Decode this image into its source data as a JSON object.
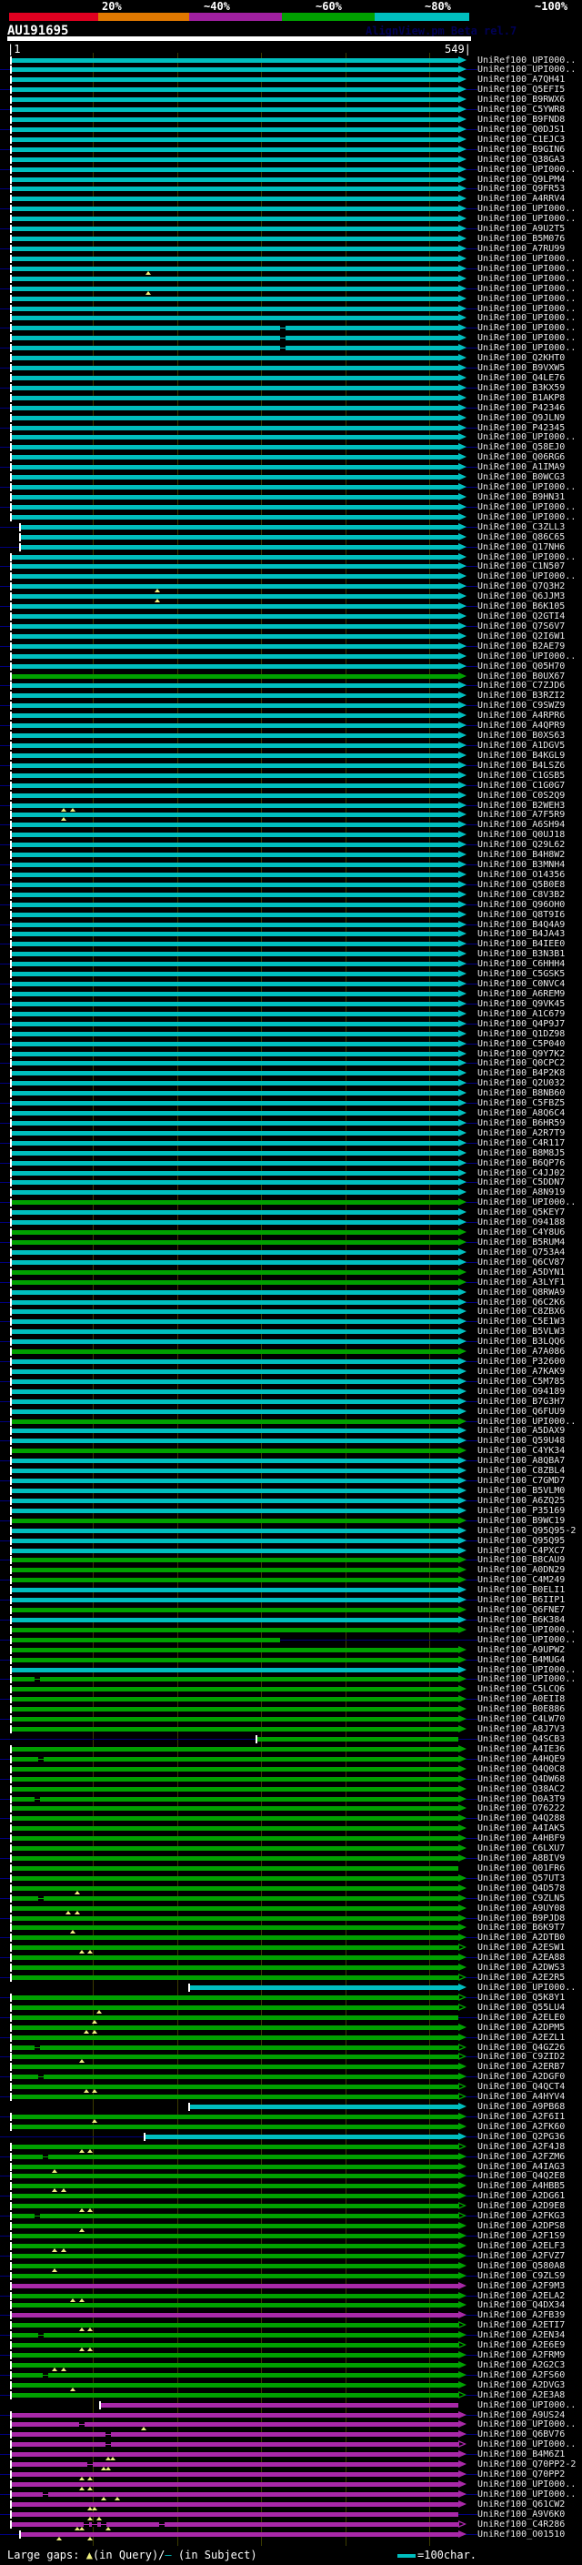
{
  "header": {
    "title": "AU191695",
    "watermark": "AlignView.pm Beta rel.7",
    "percent_labels": [
      "20%",
      "~40%",
      "~60%",
      "~80%",
      "~100%"
    ],
    "percent_label_x": [
      112,
      224,
      347,
      467,
      588
    ],
    "key_colors": [
      "#e00020",
      "#e07800",
      "#a020a0",
      "#00a000",
      "#00bebe"
    ],
    "key_widths": [
      98,
      100,
      102,
      102,
      104
    ],
    "scale_start": "|1",
    "scale_end": "549|"
  },
  "legend": {
    "prefix": "Large gaps: ",
    "triangle": "▲",
    "mid": "(in Query)/",
    "dash": "—",
    "suffix": " (in Subject)",
    "scale_label": "=100char."
  },
  "colors": {
    "cyan": "#00bebe",
    "green": "#00a000",
    "purple": "#a828a8",
    "navy": "#000080",
    "grid": "#3c3c00",
    "yellow": "#f0f080"
  },
  "grid_x": [
    102,
    195,
    287,
    380,
    472
  ],
  "rows": [
    [
      "UniRef100_UPI000..",
      "c",
      {}
    ],
    [
      "UniRef100_UPI000..",
      "c",
      {}
    ],
    [
      "UniRef100_A7QH41",
      "c",
      {}
    ],
    [
      "UniRef100_Q5EFI5",
      "c",
      {}
    ],
    [
      "UniRef100_B9RWX6",
      "c",
      {}
    ],
    [
      "UniRef100_C5YWR8",
      "c",
      {}
    ],
    [
      "UniRef100_B9FND8",
      "c",
      {}
    ],
    [
      "UniRef100_Q0DJS1",
      "c",
      {}
    ],
    [
      "UniRef100_C1EJC3",
      "c",
      {}
    ],
    [
      "UniRef100_B9GIN6",
      "c",
      {}
    ],
    [
      "UniRef100_Q38GA3",
      "c",
      {}
    ],
    [
      "UniRef100_UPI000..",
      "c",
      {}
    ],
    [
      "UniRef100_Q9LPM4",
      "c",
      {}
    ],
    [
      "UniRef100_Q9FR53",
      "c",
      {}
    ],
    [
      "UniRef100_A4RRV4",
      "c",
      {}
    ],
    [
      "UniRef100_UPI000..",
      "c",
      {}
    ],
    [
      "UniRef100_UPI000..",
      "c",
      {}
    ],
    [
      "UniRef100_A9U2T5",
      "c",
      {}
    ],
    [
      "UniRef100_B5M076",
      "c",
      {}
    ],
    [
      "UniRef100_A7RU99",
      "c",
      {}
    ],
    [
      "UniRef100_UPI000..",
      "c",
      {}
    ],
    [
      "UniRef100_UPI000..",
      "c",
      {
        "t": [
          30
        ]
      }
    ],
    [
      "UniRef100_UPI000..",
      "c",
      {}
    ],
    [
      "UniRef100_UPI000..",
      "c",
      {
        "t": [
          30
        ]
      }
    ],
    [
      "UniRef100_UPI000..",
      "c",
      {}
    ],
    [
      "UniRef100_UPI000..",
      "c",
      {}
    ],
    [
      "UniRef100_UPI000..",
      "c",
      {}
    ],
    [
      "UniRef100_UPI000..",
      "c",
      {
        "g": [
          60
        ]
      }
    ],
    [
      "UniRef100_UPI000..",
      "c",
      {
        "g": [
          60
        ]
      }
    ],
    [
      "UniRef100_UPI000..",
      "c",
      {
        "g": [
          60
        ]
      }
    ],
    [
      "UniRef100_Q2KHT0",
      "c",
      {}
    ],
    [
      "UniRef100_B9VXW5",
      "c",
      {}
    ],
    [
      "UniRef100_Q4LE76",
      "c",
      {}
    ],
    [
      "UniRef100_B3KX59",
      "c",
      {}
    ],
    [
      "UniRef100_B1AKP8",
      "c",
      {}
    ],
    [
      "UniRef100_P42346",
      "c",
      {}
    ],
    [
      "UniRef100_Q9JLN9",
      "c",
      {}
    ],
    [
      "UniRef100_P42345",
      "c",
      {}
    ],
    [
      "UniRef100_UPI000..",
      "c",
      {}
    ],
    [
      "UniRef100_Q58EJ0",
      "c",
      {}
    ],
    [
      "UniRef100_Q06RG6",
      "c",
      {}
    ],
    [
      "UniRef100_A1IMA9",
      "c",
      {}
    ],
    [
      "UniRef100_B0WCG3",
      "c",
      {}
    ],
    [
      "UniRef100_UPI000..",
      "c",
      {}
    ],
    [
      "UniRef100_B9HN31",
      "c",
      {}
    ],
    [
      "UniRef100_UPI000..",
      "c",
      {}
    ],
    [
      "UniRef100_UPI000..",
      "c",
      {}
    ],
    [
      "UniRef100_C3ZLL3",
      "c",
      {
        "s": [
          2,
          100
        ]
      }
    ],
    [
      "UniRef100_Q86C65",
      "c",
      {
        "s": [
          2,
          100
        ]
      }
    ],
    [
      "UniRef100_Q17NH6",
      "c",
      {
        "s": [
          2,
          100
        ]
      }
    ],
    [
      "UniRef100_UPI000..",
      "c",
      {}
    ],
    [
      "UniRef100_C1N507",
      "c",
      {}
    ],
    [
      "UniRef100_UPI000..",
      "c",
      {}
    ],
    [
      "UniRef100_Q7Q3H2",
      "c",
      {
        "t": [
          32
        ]
      }
    ],
    [
      "UniRef100_Q6JJM3",
      "c",
      {
        "t": [
          32
        ]
      }
    ],
    [
      "UniRef100_B6K105",
      "c",
      {}
    ],
    [
      "UniRef100_Q2GTI4",
      "c",
      {}
    ],
    [
      "UniRef100_Q7S6V7",
      "c",
      {}
    ],
    [
      "UniRef100_Q2I6W1",
      "c",
      {}
    ],
    [
      "UniRef100_B2AE79",
      "c",
      {}
    ],
    [
      "UniRef100_UPI000..",
      "c",
      {}
    ],
    [
      "UniRef100_Q05H70",
      "c",
      {}
    ],
    [
      "UniRef100_B0UX67",
      "g",
      {}
    ],
    [
      "UniRef100_C7ZJD6",
      "c",
      {}
    ],
    [
      "UniRef100_B3RZI2",
      "c",
      {}
    ],
    [
      "UniRef100_C9SWZ9",
      "c",
      {}
    ],
    [
      "UniRef100_A4RPR6",
      "c",
      {}
    ],
    [
      "UniRef100_A4QPR9",
      "c",
      {}
    ],
    [
      "UniRef100_B0XS63",
      "c",
      {}
    ],
    [
      "UniRef100_A1DGV5",
      "c",
      {}
    ],
    [
      "UniRef100_B4KGL9",
      "c",
      {}
    ],
    [
      "UniRef100_B4LSZ6",
      "c",
      {}
    ],
    [
      "UniRef100_C1GSB5",
      "c",
      {}
    ],
    [
      "UniRef100_C1G0G7",
      "c",
      {}
    ],
    [
      "UniRef100_C0S2Q9",
      "c",
      {}
    ],
    [
      "UniRef100_B2WEH3",
      "c",
      {
        "t": [
          11,
          13
        ]
      }
    ],
    [
      "UniRef100_A7F5R9",
      "c",
      {
        "t": [
          11
        ]
      }
    ],
    [
      "UniRef100_A6SH94",
      "c",
      {}
    ],
    [
      "UniRef100_Q0UJ18",
      "c",
      {}
    ],
    [
      "UniRef100_Q29L62",
      "c",
      {}
    ],
    [
      "UniRef100_B4H8W2",
      "c",
      {}
    ],
    [
      "UniRef100_B3MNH4",
      "c",
      {}
    ],
    [
      "UniRef100_O14356",
      "c",
      {}
    ],
    [
      "UniRef100_Q5B0E8",
      "c",
      {}
    ],
    [
      "UniRef100_C8V3B2",
      "c",
      {}
    ],
    [
      "UniRef100_Q96OH0",
      "c",
      {}
    ],
    [
      "UniRef100_Q8T9I6",
      "c",
      {}
    ],
    [
      "UniRef100_B4Q4A9",
      "c",
      {}
    ],
    [
      "UniRef100_B4JA43",
      "c",
      {}
    ],
    [
      "UniRef100_B4IEE0",
      "c",
      {}
    ],
    [
      "UniRef100_B3N3B1",
      "c",
      {}
    ],
    [
      "UniRef100_C6HHH4",
      "c",
      {}
    ],
    [
      "UniRef100_C5GSK5",
      "c",
      {}
    ],
    [
      "UniRef100_C0NVC4",
      "c",
      {}
    ],
    [
      "UniRef100_A6REM9",
      "c",
      {}
    ],
    [
      "UniRef100_Q9VK45",
      "c",
      {}
    ],
    [
      "UniRef100_A1C679",
      "c",
      {}
    ],
    [
      "UniRef100_Q4P9J7",
      "c",
      {}
    ],
    [
      "UniRef100_Q1DZ98",
      "c",
      {}
    ],
    [
      "UniRef100_C5P040",
      "c",
      {}
    ],
    [
      "UniRef100_Q9Y7K2",
      "c",
      {}
    ],
    [
      "UniRef100_Q0CPC2",
      "c",
      {}
    ],
    [
      "UniRef100_B4P2K8",
      "c",
      {}
    ],
    [
      "UniRef100_Q2U032",
      "c",
      {}
    ],
    [
      "UniRef100_B8NB60",
      "c",
      {}
    ],
    [
      "UniRef100_C5FBZ5",
      "c",
      {}
    ],
    [
      "UniRef100_A8Q6C4",
      "c",
      {}
    ],
    [
      "UniRef100_B6HR59",
      "c",
      {}
    ],
    [
      "UniRef100_A2R7T9",
      "c",
      {}
    ],
    [
      "UniRef100_C4R117",
      "c",
      {}
    ],
    [
      "UniRef100_B8M8J5",
      "c",
      {}
    ],
    [
      "UniRef100_B6QP76",
      "c",
      {}
    ],
    [
      "UniRef100_C4JJ02",
      "c",
      {}
    ],
    [
      "UniRef100_C5DDN7",
      "c",
      {}
    ],
    [
      "UniRef100_A8N919",
      "c",
      {}
    ],
    [
      "UniRef100_UPI000..",
      "g",
      {}
    ],
    [
      "UniRef100_Q5KEY7",
      "c",
      {}
    ],
    [
      "UniRef100_O94188",
      "c",
      {}
    ],
    [
      "UniRef100_C4Y8U6",
      "g",
      {}
    ],
    [
      "UniRef100_B5RUM4",
      "g",
      {}
    ],
    [
      "UniRef100_Q753A4",
      "c",
      {}
    ],
    [
      "UniRef100_Q6CV87",
      "c",
      {}
    ],
    [
      "UniRef100_A5DYN1",
      "g",
      {}
    ],
    [
      "UniRef100_A3LYF1",
      "g",
      {}
    ],
    [
      "UniRef100_Q8RWA9",
      "c",
      {}
    ],
    [
      "UniRef100_Q6C2K6",
      "c",
      {}
    ],
    [
      "UniRef100_C8ZBX6",
      "c",
      {}
    ],
    [
      "UniRef100_C5E1W3",
      "c",
      {}
    ],
    [
      "UniRef100_B5VLW3",
      "c",
      {}
    ],
    [
      "UniRef100_B3LQQ6",
      "c",
      {}
    ],
    [
      "UniRef100_A7A086",
      "g",
      {}
    ],
    [
      "UniRef100_P32600",
      "c",
      {}
    ],
    [
      "UniRef100_A7KAK9",
      "c",
      {}
    ],
    [
      "UniRef100_C5M785",
      "c",
      {}
    ],
    [
      "UniRef100_O94189",
      "c",
      {}
    ],
    [
      "UniRef100_B7G3H7",
      "c",
      {}
    ],
    [
      "UniRef100_Q6FUU9",
      "c",
      {}
    ],
    [
      "UniRef100_UPI000..",
      "g",
      {}
    ],
    [
      "UniRef100_A5DAX9",
      "c",
      {}
    ],
    [
      "UniRef100_Q59U48",
      "c",
      {}
    ],
    [
      "UniRef100_C4YK34",
      "g",
      {}
    ],
    [
      "UniRef100_A8QBA7",
      "c",
      {}
    ],
    [
      "UniRef100_C8ZBL4",
      "c",
      {}
    ],
    [
      "UniRef100_C7GMD7",
      "c",
      {}
    ],
    [
      "UniRef100_B5VLM0",
      "c",
      {}
    ],
    [
      "UniRef100_A6ZQ25",
      "c",
      {}
    ],
    [
      "UniRef100_P35169",
      "c",
      {}
    ],
    [
      "UniRef100_B9WC19",
      "g",
      {}
    ],
    [
      "UniRef100_Q95Q95-2",
      "c",
      {}
    ],
    [
      "UniRef100_Q95Q95",
      "c",
      {}
    ],
    [
      "UniRef100_C4PXC7",
      "c",
      {}
    ],
    [
      "UniRef100_B8CAU9",
      "g",
      {}
    ],
    [
      "UniRef100_A0DN29",
      "g",
      {}
    ],
    [
      "UniRef100_C4M249",
      "g",
      {}
    ],
    [
      "UniRef100_B0ELI1",
      "c",
      {}
    ],
    [
      "UniRef100_B6IIP1",
      "c",
      {}
    ],
    [
      "UniRef100_Q6FNE7",
      "g",
      {}
    ],
    [
      "UniRef100_B6K384",
      "c",
      {}
    ],
    [
      "UniRef100_UPI000..",
      "g",
      {}
    ],
    [
      "UniRef100_UPI000..",
      "g",
      {
        "s": [
          0,
          60
        ],
        "na": 1
      }
    ],
    [
      "UniRef100_A9UPW2",
      "g",
      {}
    ],
    [
      "UniRef100_B4MUG4",
      "g",
      {}
    ],
    [
      "UniRef100_UPI000..",
      "c",
      {}
    ],
    [
      "UniRef100_UPI000..",
      "g",
      {
        "g": [
          5
        ]
      }
    ],
    [
      "UniRef100_C5LCQ6",
      "g",
      {}
    ],
    [
      "UniRef100_A0EII8",
      "g",
      {}
    ],
    [
      "UniRef100_B0E886",
      "g",
      {}
    ],
    [
      "UniRef100_C4LW70",
      "g",
      {}
    ],
    [
      "UniRef100_A8J7V3",
      "g",
      {}
    ],
    [
      "UniRef100_Q4SCB3",
      "g",
      {
        "s": [
          55,
          100
        ],
        "na": 1
      }
    ],
    [
      "UniRef100_A4IE36",
      "g",
      {}
    ],
    [
      "UniRef100_A4HQE9",
      "g",
      {
        "g": [
          6
        ]
      }
    ],
    [
      "UniRef100_Q4Q0C8",
      "g",
      {}
    ],
    [
      "UniRef100_Q4DW68",
      "g",
      {}
    ],
    [
      "UniRef100_Q38AC2",
      "g",
      {}
    ],
    [
      "UniRef100_D0A3T9",
      "g",
      {
        "g": [
          5
        ]
      }
    ],
    [
      "UniRef100_O76222",
      "g",
      {}
    ],
    [
      "UniRef100_Q4Q288",
      "g",
      {}
    ],
    [
      "UniRef100_A4IAK5",
      "g",
      {}
    ],
    [
      "UniRef100_A4HBF9",
      "g",
      {}
    ],
    [
      "UniRef100_C6LXU7",
      "g",
      {}
    ],
    [
      "UniRef100_A8BIV9",
      "g",
      {}
    ],
    [
      "UniRef100_Q01FR6",
      "g",
      {
        "na": 1
      }
    ],
    [
      "UniRef100_Q57UT3",
      "g",
      {}
    ],
    [
      "UniRef100_Q4D578",
      "g",
      {
        "t": [
          14
        ]
      }
    ],
    [
      "UniRef100_C9ZLN5",
      "g",
      {
        "g": [
          6
        ]
      }
    ],
    [
      "UniRef100_A9UY08",
      "g",
      {
        "t": [
          12,
          14
        ]
      }
    ],
    [
      "UniRef100_B9PJD8",
      "g",
      {}
    ],
    [
      "UniRef100_B6K9T7",
      "g",
      {
        "t": [
          13
        ]
      }
    ],
    [
      "UniRef100_A2DTB0",
      "g",
      {}
    ],
    [
      "UniRef100_A2ESW1",
      "g",
      {
        "h": 1,
        "t": [
          15,
          17
        ]
      }
    ],
    [
      "UniRef100_A2EA88",
      "g",
      {}
    ],
    [
      "UniRef100_A2DWS3",
      "g",
      {}
    ],
    [
      "UniRef100_A2E2R5",
      "g",
      {
        "h": 1
      }
    ],
    [
      "UniRef100_UPI000..",
      "c",
      {
        "s": [
          40,
          100
        ]
      }
    ],
    [
      "UniRef100_Q5K8Y1",
      "g",
      {
        "h": 1
      }
    ],
    [
      "UniRef100_Q55LU4",
      "g",
      {
        "h": 1,
        "t": [
          19
        ]
      }
    ],
    [
      "UniRef100_A2ELE0",
      "g",
      {
        "na": 1,
        "t": [
          18
        ]
      }
    ],
    [
      "UniRef100_A2DPM5",
      "g",
      {
        "t": [
          16,
          18
        ]
      }
    ],
    [
      "UniRef100_A2EZL1",
      "g",
      {}
    ],
    [
      "UniRef100_Q4GZ26",
      "g",
      {
        "h": 1,
        "g": [
          5
        ]
      }
    ],
    [
      "UniRef100_C9ZID2",
      "g",
      {
        "h": 1,
        "t": [
          15
        ]
      }
    ],
    [
      "UniRef100_A2ERB7",
      "g",
      {}
    ],
    [
      "UniRef100_A2DGF0",
      "g",
      {
        "g": [
          6
        ]
      }
    ],
    [
      "UniRef100_Q4QCT4",
      "g",
      {
        "h": 1,
        "t": [
          16,
          18
        ]
      }
    ],
    [
      "UniRef100_A4HYV4",
      "g",
      {
        "h": 1
      }
    ],
    [
      "UniRef100_A9PB68",
      "c",
      {
        "s": [
          40,
          100
        ]
      }
    ],
    [
      "UniRef100_A2F6I1",
      "g",
      {
        "t": [
          18
        ]
      }
    ],
    [
      "UniRef100_A2FK60",
      "g",
      {}
    ],
    [
      "UniRef100_Q2PG36",
      "c",
      {
        "s": [
          30,
          100
        ]
      }
    ],
    [
      "UniRef100_A2F4J8",
      "g",
      {
        "h": 1,
        "t": [
          15,
          17
        ]
      }
    ],
    [
      "UniRef100_A2FZM6",
      "g",
      {
        "g": [
          7
        ]
      }
    ],
    [
      "UniRef100_A4IAG3",
      "g",
      {
        "t": [
          9
        ]
      }
    ],
    [
      "UniRef100_Q4Q2E8",
      "g",
      {}
    ],
    [
      "UniRef100_A4HBB5",
      "g",
      {
        "t": [
          9,
          11
        ]
      }
    ],
    [
      "UniRef100_A2DG61",
      "g",
      {}
    ],
    [
      "UniRef100_A2D9E8",
      "g",
      {
        "h": 1,
        "t": [
          15,
          17
        ]
      }
    ],
    [
      "UniRef100_A2FKG3",
      "g",
      {
        "h": 1,
        "g": [
          5
        ]
      }
    ],
    [
      "UniRef100_A2DPS8",
      "g",
      {
        "t": [
          15
        ]
      }
    ],
    [
      "UniRef100_A2F1S9",
      "g",
      {}
    ],
    [
      "UniRef100_A2ELF3",
      "g",
      {
        "t": [
          9,
          11
        ]
      }
    ],
    [
      "UniRef100_A2FVZ7",
      "g",
      {}
    ],
    [
      "UniRef100_Q580A8",
      "g",
      {
        "t": [
          9
        ]
      }
    ],
    [
      "UniRef100_C9ZLS9",
      "g",
      {}
    ],
    [
      "UniRef100_A2F9M3",
      "p",
      {}
    ],
    [
      "UniRef100_A2ELA2",
      "g",
      {
        "t": [
          13,
          15
        ]
      }
    ],
    [
      "UniRef100_Q4DX34",
      "g",
      {}
    ],
    [
      "UniRef100_A2FB39",
      "p",
      {}
    ],
    [
      "UniRef100_A2ETI7",
      "g",
      {
        "h": 1,
        "t": [
          15,
          17
        ]
      }
    ],
    [
      "UniRef100_A2EN34",
      "g",
      {
        "g": [
          6
        ]
      }
    ],
    [
      "UniRef100_A2E6E9",
      "g",
      {
        "h": 1,
        "t": [
          15,
          17
        ]
      }
    ],
    [
      "UniRef100_A2FRM9",
      "g",
      {}
    ],
    [
      "UniRef100_A2G2C3",
      "g",
      {
        "t": [
          9,
          11
        ]
      }
    ],
    [
      "UniRef100_A2FS60",
      "g",
      {
        "g": [
          7
        ]
      }
    ],
    [
      "UniRef100_A2DVG3",
      "g",
      {
        "t": [
          13
        ]
      }
    ],
    [
      "UniRef100_A2E3A8",
      "g",
      {
        "h": 1
      }
    ],
    [
      "UniRef100_UPI000..",
      "p",
      {
        "s": [
          20,
          100
        ],
        "na": 1
      }
    ],
    [
      "UniRef100_A9US24",
      "p",
      {}
    ],
    [
      "UniRef100_UPI000..",
      "p",
      {
        "g": [
          15
        ],
        "t": [
          29
        ]
      }
    ],
    [
      "UniRef100_Q6BV76",
      "p",
      {
        "g": [
          21
        ]
      }
    ],
    [
      "UniRef100_UPI000..",
      "p",
      {
        "h": 1,
        "g": [
          21
        ]
      }
    ],
    [
      "UniRef100_B4M6Z1",
      "p",
      {
        "t": [
          21,
          22
        ]
      }
    ],
    [
      "UniRef100_Q70PP2-2",
      "p",
      {
        "g": [
          17
        ],
        "t": [
          20,
          21
        ]
      }
    ],
    [
      "UniRef100_Q70PP2",
      "p",
      {
        "t": [
          15,
          17
        ]
      }
    ],
    [
      "UniRef100_UPI000..",
      "p",
      {
        "t": [
          15,
          17
        ]
      }
    ],
    [
      "UniRef100_UPI000..",
      "p",
      {
        "g": [
          7
        ],
        "t": [
          20,
          23
        ]
      }
    ],
    [
      "UniRef100_Q61CW2",
      "p",
      {
        "t": [
          17,
          18
        ]
      }
    ],
    [
      "UniRef100_A9V6K0",
      "p",
      {
        "na": 1,
        "t": [
          17,
          19
        ]
      }
    ],
    [
      "UniRef100_C4R286",
      "p",
      {
        "h": 1,
        "g": [
          16,
          18,
          20,
          33
        ],
        "t": [
          14,
          15,
          21
        ]
      }
    ],
    [
      "UniRef100_O01510",
      "p",
      {
        "s": [
          2,
          100
        ],
        "t": [
          10,
          17
        ]
      }
    ]
  ]
}
